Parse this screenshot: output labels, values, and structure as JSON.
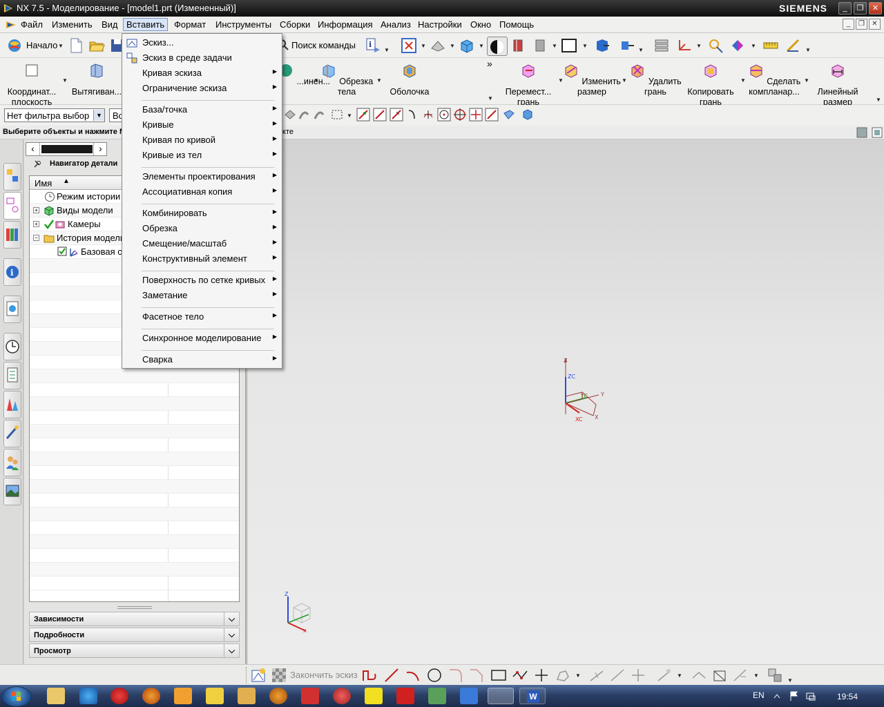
{
  "window": {
    "title": "NX 7.5 - Моделирование - [model1.prt (Измененный)]",
    "brand": "SIEMENS"
  },
  "menubar": {
    "items": [
      "Файл",
      "Изменить",
      "Вид",
      "Вставить",
      "Формат",
      "Инструменты",
      "Сборки",
      "Информация",
      "Анализ",
      "Настройки",
      "Окно",
      "Помощь"
    ]
  },
  "toolbar1": {
    "start_label": "Начало",
    "search_label": "Поиск команды"
  },
  "toolbar2": {
    "left_buttons": [
      "Координат... плоскость",
      "Вытягиван..."
    ],
    "mid_buttons": [
      "...инен...",
      "Обрезка тела",
      "Оболочка"
    ],
    "sync_buttons": [
      "Перемест... грань",
      "Изменить размер",
      "Удалить грань",
      "Копировать грань",
      "Сделать компланар...",
      "Линейный размер"
    ]
  },
  "toolbar3": {
    "filter_value": "Нет фильтра выбор",
    "scope_value": "Во"
  },
  "cue_line": {
    "text": "Выберите объекты и нажмите М",
    "text_right": "кте"
  },
  "insert_menu": {
    "groups": [
      [
        "Эскиз...",
        "Эскиз в среде задачи",
        "Кривая эскиза",
        "Ограничение эскиза"
      ],
      [
        "База/точка",
        "Кривые",
        "Кривая по кривой",
        "Кривые из тел"
      ],
      [
        "Элементы проектирования",
        "Ассоциативная копия"
      ],
      [
        "Комбинировать",
        "Обрезка",
        "Смещение/масштаб",
        "Конструктивный элемент"
      ],
      [
        "Поверхность по сетке кривых",
        "Заметание"
      ],
      [
        "Фасетное тело"
      ],
      [
        "Синхронное моделирование"
      ],
      [
        "Сварка"
      ]
    ],
    "submenu_flags": [
      [
        false,
        false,
        true,
        true
      ],
      [
        true,
        true,
        true,
        true
      ],
      [
        true,
        true
      ],
      [
        true,
        true,
        true,
        true
      ],
      [
        true,
        true
      ],
      [
        true
      ],
      [
        true
      ],
      [
        true
      ]
    ]
  },
  "navigator": {
    "title": "Навигатор детали",
    "column_name": "Имя",
    "rows": [
      {
        "label": "Режим истории",
        "icon": "clock-icon"
      },
      {
        "label": "Виды модели",
        "icon": "cube-views-icon"
      },
      {
        "label": "Камеры",
        "icon": "camera-icon"
      },
      {
        "label": "История модели",
        "icon": "folder-icon"
      },
      {
        "label": "Базовая с",
        "icon": "datum-csys-icon"
      }
    ],
    "panels": [
      "Зависимости",
      "Подробности",
      "Просмотр"
    ]
  },
  "graphics": {
    "triad_labels": {
      "z": "Z",
      "zc": "ZC",
      "y": "Y",
      "yc": "YC",
      "x": "X",
      "xc": "XC"
    }
  },
  "sketchbar": {
    "finish_label": "Закончить эскиз"
  },
  "taskbar": {
    "lang": "EN",
    "time": "19:54"
  }
}
